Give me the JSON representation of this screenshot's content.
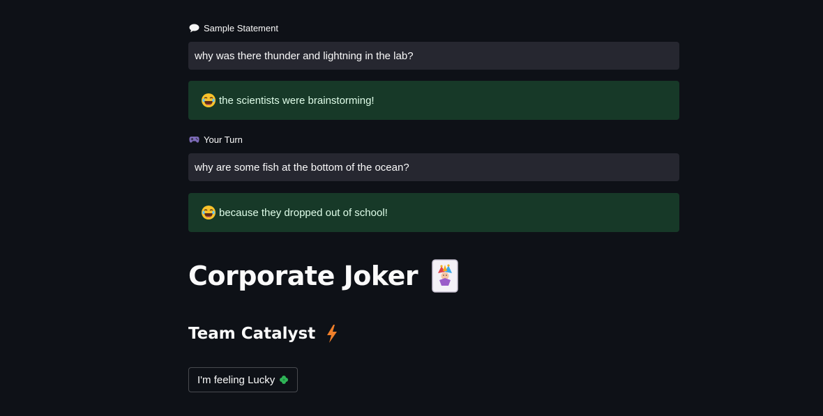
{
  "sample": {
    "label": "Sample Statement",
    "label_icon": "speech-bubble-icon",
    "question": "why was there thunder and lightning in the lab?",
    "answer": "the scientists were brainstorming!",
    "answer_icon": "laughing-face-icon"
  },
  "your_turn": {
    "label": "Your Turn",
    "label_icon": "game-controller-icon",
    "question": "why are some fish at the bottom of the ocean?",
    "answer": "because they dropped out of school!",
    "answer_icon": "laughing-face-icon"
  },
  "header": {
    "title": "Corporate Joker",
    "title_icon": "joker-card-icon",
    "subtitle": "Team Catalyst",
    "subtitle_icon": "lightning-bolt-icon"
  },
  "actions": {
    "lucky_label": "I'm feeling Lucky",
    "lucky_icon": "four-leaf-clover-icon"
  },
  "colors": {
    "background": "#0e1117",
    "input_bg": "#262730",
    "success_bg": "#173928",
    "success_text": "#dffde9"
  }
}
